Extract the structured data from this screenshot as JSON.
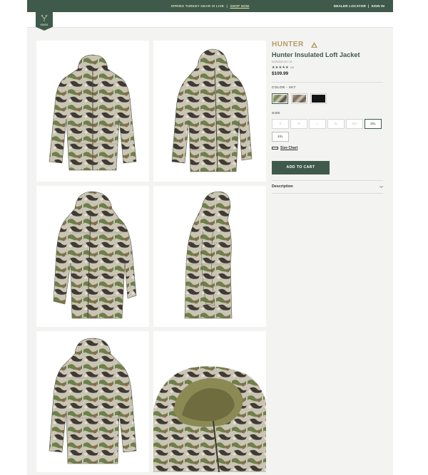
{
  "topbar": {
    "promo_text": "SPRING TURKEY GEAR IS LIVE",
    "promo_link": "SHOP NOW",
    "separator": "|",
    "dealer_locator": "DEALER LOCATOR",
    "sign_in": "SIGN IN"
  },
  "logo": {
    "brand": "KINGS"
  },
  "product": {
    "brand": "HUNTER",
    "title": "Hunter Insulated Loft Jacket",
    "sku": "KCR6320-XK7-XL",
    "stars": "★★★★★",
    "review_count": "19",
    "price": "$109.99",
    "color_label": "COLOR - XK7",
    "size_label": "SIZE",
    "sizes": [
      "S",
      "M",
      "L",
      "XL",
      "2XL",
      "3XL",
      "4XL"
    ],
    "selected_size": "3XL",
    "size_chart": "Size Chart",
    "add_to_cart": "ADD TO CART",
    "description": "Description"
  },
  "colors": {
    "accent": "#3f5a4b",
    "brand_gold": "#b79b64",
    "promo": "#d8dfb0"
  }
}
